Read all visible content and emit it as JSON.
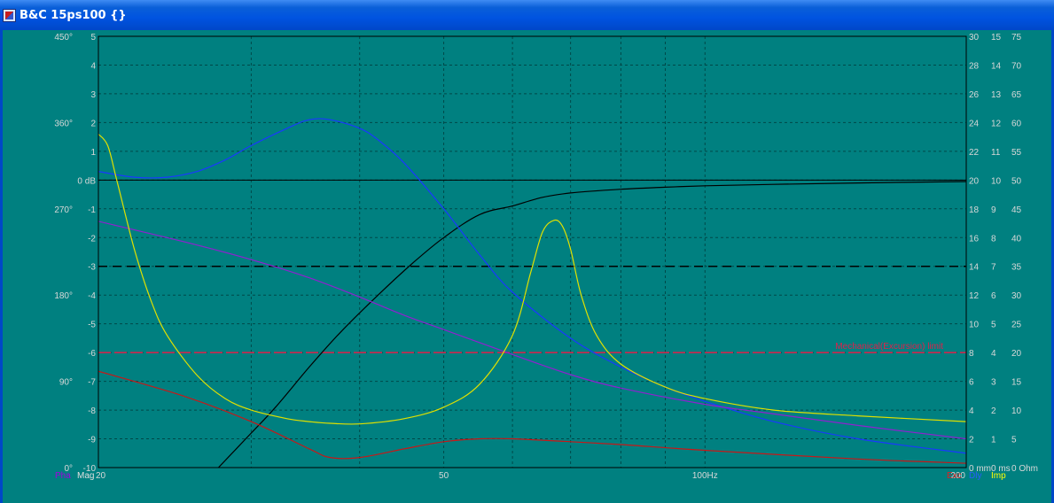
{
  "window": {
    "title": "B&C 15ps100 {}"
  },
  "chart_data": {
    "type": "line",
    "x_scale": "log",
    "xlim": [
      20,
      200
    ],
    "x_tick_labels": [
      {
        "value": 20,
        "label": "20"
      },
      {
        "value": 50,
        "label": "50"
      },
      {
        "value": 100,
        "label": "100Hz"
      },
      {
        "value": 200,
        "label": "200"
      }
    ],
    "x_grid": [
      20,
      30,
      40,
      50,
      60,
      70,
      80,
      90,
      100,
      200
    ],
    "y_axes": {
      "phase": {
        "unit": "°",
        "range": [
          0,
          450
        ],
        "labels": [
          {
            "value": 450,
            "label": "450°"
          },
          {
            "value": 360,
            "label": "360°"
          },
          {
            "value": 270,
            "label": "270°"
          },
          {
            "value": 180,
            "label": "180°"
          },
          {
            "value": 90,
            "label": "90°"
          },
          {
            "value": 0,
            "label": "0°"
          }
        ]
      },
      "magnitude": {
        "unit": "dB",
        "range": [
          -10,
          5
        ],
        "labels": [
          {
            "value": 5,
            "label": "5"
          },
          {
            "value": 4,
            "label": "4"
          },
          {
            "value": 3,
            "label": "3"
          },
          {
            "value": 2,
            "label": "2"
          },
          {
            "value": 1,
            "label": "1"
          },
          {
            "value": 0,
            "label": "0 dB"
          },
          {
            "value": -1,
            "label": "-1"
          },
          {
            "value": -2,
            "label": "-2"
          },
          {
            "value": -3,
            "label": "-3"
          },
          {
            "value": -4,
            "label": "-4"
          },
          {
            "value": -5,
            "label": "-5"
          },
          {
            "value": -6,
            "label": "-6"
          },
          {
            "value": -7,
            "label": "-7"
          },
          {
            "value": -8,
            "label": "-8"
          },
          {
            "value": -9,
            "label": "-9"
          },
          {
            "value": -10,
            "label": "-10"
          }
        ]
      },
      "excursion": {
        "unit": "mm",
        "range": [
          0,
          30
        ],
        "labels": [
          "30",
          "28",
          "26",
          "24",
          "22",
          "20",
          "18",
          "16",
          "14",
          "12",
          "10",
          "8",
          "6",
          "4",
          "2",
          "0 mm"
        ]
      },
      "delay": {
        "unit": "ms",
        "range": [
          0,
          15
        ],
        "labels": [
          "15",
          "14",
          "13",
          "12",
          "11",
          "10",
          "9",
          "8",
          "7",
          "6",
          "5",
          "4",
          "3",
          "2",
          "1",
          "0 ms"
        ]
      },
      "impedance": {
        "unit": "Ohm",
        "range": [
          0,
          75
        ],
        "labels": [
          "75",
          "70",
          "65",
          "60",
          "55",
          "50",
          "45",
          "40",
          "35",
          "30",
          "25",
          "20",
          "15",
          "10",
          "5",
          "0 Ohm"
        ]
      }
    },
    "reference_lines": [
      {
        "axis": "magnitude",
        "value": 0,
        "style": "solid",
        "color": "#000000"
      },
      {
        "axis": "magnitude",
        "value": -3,
        "style": "dashed",
        "color": "#000000"
      },
      {
        "axis": "excursion",
        "value": 8,
        "style": "dashed",
        "color": "#e0204a",
        "label": "Mechanical(Excursion) limit"
      }
    ],
    "legend": [
      {
        "key": "pha",
        "label": "Pha",
        "color": "#a000e0",
        "position": "bottom-left"
      },
      {
        "key": "mag",
        "label": "Mag",
        "color": "#e0e0e0",
        "position": "bottom-left"
      },
      {
        "key": "exc",
        "label": "Exc",
        "color": "#e02020",
        "position": "bottom-right"
      },
      {
        "key": "dly",
        "label": "Dly",
        "color": "#2a5cff",
        "position": "bottom-right"
      },
      {
        "key": "imp",
        "label": "Imp",
        "color": "#ffff00",
        "position": "bottom-right"
      }
    ],
    "series": [
      {
        "key": "mag",
        "color": "#000000",
        "axis": "magnitude",
        "x": [
          27.5,
          30,
          32,
          35,
          38,
          42,
          46,
          50,
          55,
          60,
          65,
          70,
          80,
          90,
          100,
          120,
          150,
          200
        ],
        "y": [
          -10,
          -8.8,
          -7.9,
          -6.5,
          -5.3,
          -4.0,
          -2.9,
          -2.0,
          -1.2,
          -0.9,
          -0.6,
          -0.45,
          -0.32,
          -0.25,
          -0.2,
          -0.15,
          -0.1,
          -0.05
        ]
      },
      {
        "key": "dly",
        "color": "#1a38ff",
        "axis": "delay",
        "x": [
          20,
          22,
          24,
          26,
          28,
          30,
          33,
          35,
          37,
          40,
          42,
          45,
          50,
          55,
          60,
          70,
          80,
          90,
          100,
          120,
          150,
          200
        ],
        "y": [
          10.3,
          10.1,
          10.1,
          10.3,
          10.7,
          11.2,
          11.8,
          12.1,
          12.1,
          11.8,
          11.4,
          10.6,
          9.0,
          7.4,
          6.1,
          4.5,
          3.5,
          2.8,
          2.3,
          1.6,
          1.0,
          0.5
        ]
      },
      {
        "key": "pha",
        "color": "#9020d0",
        "axis": "phase",
        "x": [
          20,
          25,
          30,
          35,
          40,
          45,
          50,
          60,
          70,
          80,
          100,
          120,
          150,
          200
        ],
        "y": [
          257,
          236,
          217,
          198,
          178,
          159,
          144,
          118,
          97,
          83,
          66,
          56,
          44,
          30
        ]
      },
      {
        "key": "exc",
        "color": "#c81818",
        "axis": "excursion",
        "x": [
          20,
          25,
          30,
          35,
          37,
          40,
          45,
          50,
          55,
          60,
          70,
          80,
          100,
          150,
          200
        ],
        "y": [
          6.7,
          5.0,
          3.2,
          1.3,
          0.7,
          0.7,
          1.3,
          1.8,
          2.0,
          2.0,
          1.8,
          1.6,
          1.2,
          0.6,
          0.3
        ]
      },
      {
        "key": "imp",
        "color": "#e0e000",
        "axis": "impedance",
        "x": [
          20,
          20.5,
          21,
          22,
          23,
          24,
          26,
          28,
          30,
          33,
          35,
          37,
          40,
          45,
          50,
          55,
          60,
          63,
          65,
          67,
          68.5,
          70,
          72,
          75,
          80,
          90,
          100,
          120,
          150,
          200
        ],
        "y": [
          58,
          56,
          50,
          38,
          29,
          23,
          16,
          12,
          10,
          8.5,
          8,
          7.7,
          7.6,
          8.5,
          10.5,
          14.5,
          23,
          34,
          41,
          43,
          42,
          38,
          30,
          23,
          18,
          14,
          12,
          10,
          9,
          8
        ]
      }
    ]
  }
}
